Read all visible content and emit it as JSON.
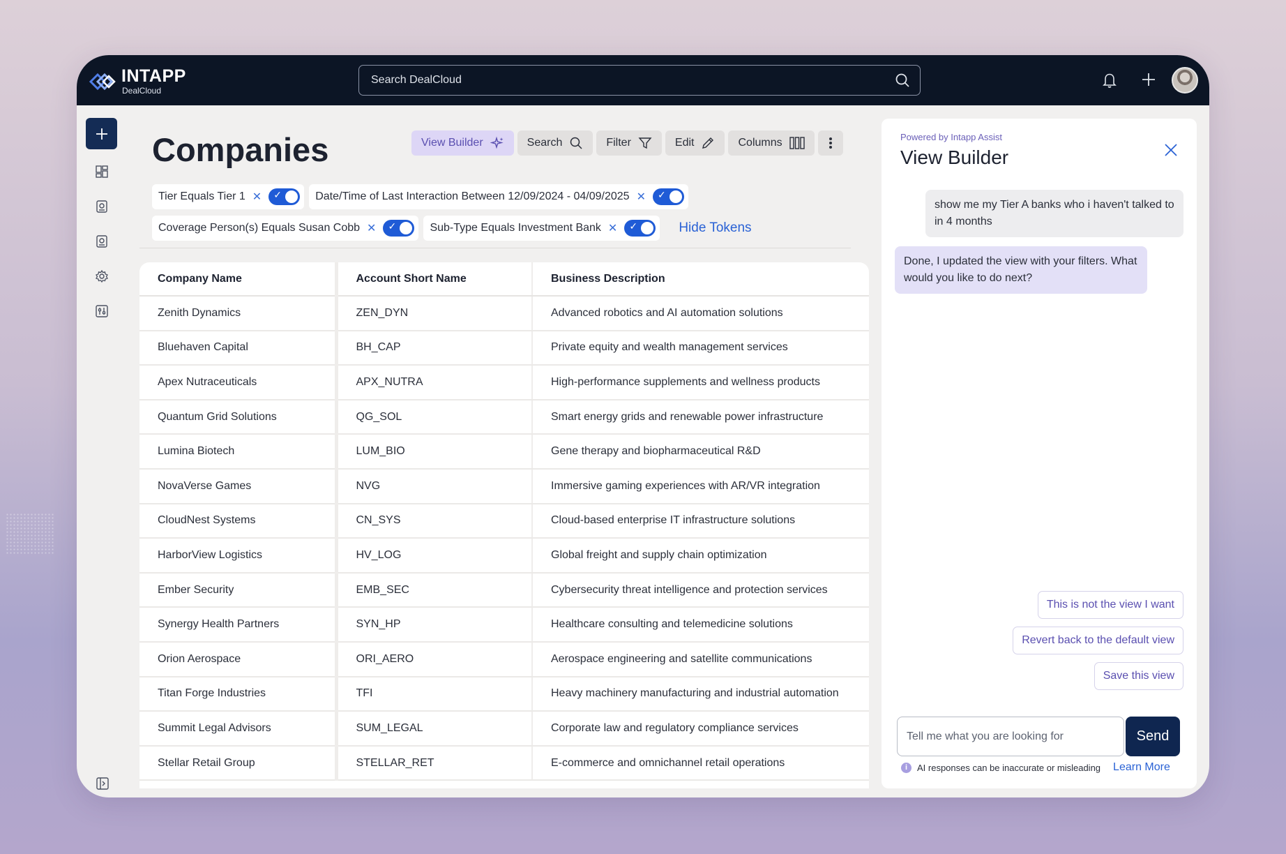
{
  "brand": {
    "name": "INTAPP",
    "sub": "DealCloud"
  },
  "search": {
    "placeholder": "Search DealCloud"
  },
  "page": {
    "title": "Companies"
  },
  "toolbar": {
    "view_builder": "View Builder",
    "search": "Search",
    "filter": "Filter",
    "edit": "Edit",
    "columns": "Columns"
  },
  "tokens": [
    {
      "label": "Tier Equals Tier 1",
      "on": true
    },
    {
      "label": "Date/Time of Last Interaction Between 12/09/2024 - 04/09/2025",
      "on": true
    },
    {
      "label": "Coverage Person(s) Equals Susan Cobb",
      "on": true
    },
    {
      "label": "Sub-Type Equals Investment Bank",
      "on": true
    }
  ],
  "hide_tokens": "Hide Tokens",
  "table": {
    "headers": [
      "Company Name",
      "Account Short Name",
      "Business Description"
    ],
    "rows": [
      [
        "Zenith Dynamics",
        "ZEN_DYN",
        "Advanced robotics and AI automation solutions"
      ],
      [
        "Bluehaven Capital",
        "BH_CAP",
        "Private equity and wealth management services"
      ],
      [
        "Apex Nutraceuticals",
        "APX_NUTRA",
        "High-performance supplements and wellness products"
      ],
      [
        "Quantum Grid Solutions",
        "QG_SOL",
        "Smart energy grids and renewable power infrastructure"
      ],
      [
        "Lumina Biotech",
        "LUM_BIO",
        "Gene therapy and biopharmaceutical R&D"
      ],
      [
        "NovaVerse Games",
        "NVG",
        "Immersive gaming experiences with AR/VR integration"
      ],
      [
        "CloudNest Systems",
        "CN_SYS",
        "Cloud-based enterprise IT infrastructure solutions"
      ],
      [
        "HarborView Logistics",
        "HV_LOG",
        "Global freight and supply chain optimization"
      ],
      [
        "Ember Security",
        "EMB_SEC",
        "Cybersecurity threat intelligence and protection services"
      ],
      [
        "Synergy Health Partners",
        "SYN_HP",
        "Healthcare consulting and telemedicine solutions"
      ],
      [
        "Orion Aerospace",
        "ORI_AERO",
        "Aerospace engineering and satellite communications"
      ],
      [
        "Titan Forge Industries",
        "TFI",
        "Heavy machinery manufacturing and industrial automation"
      ],
      [
        "Summit Legal Advisors",
        "SUM_LEGAL",
        "Corporate law and regulatory compliance services"
      ],
      [
        "Stellar Retail Group",
        "STELLAR_RET",
        "E-commerce and omnichannel retail operations"
      ]
    ]
  },
  "assistant": {
    "powered_by": "Powered by Intapp Assist",
    "title": "View Builder",
    "user_message": "show me my Tier A banks who i haven't talked to in 4 months",
    "bot_message": "Done, I updated the view with your filters. What would you like to do next?",
    "chips": [
      "This is not the view I want",
      "Revert back to the default view",
      "Save this view"
    ],
    "input_placeholder": "Tell me what you are looking for",
    "send": "Send",
    "disclaimer": "AI responses can be inaccurate or misleading",
    "learn_more": "Learn More"
  },
  "colors": {
    "nav": "#0c1525",
    "accent": "#1f5bd6",
    "assist": "#5a4fb0",
    "send": "#0f2650"
  }
}
